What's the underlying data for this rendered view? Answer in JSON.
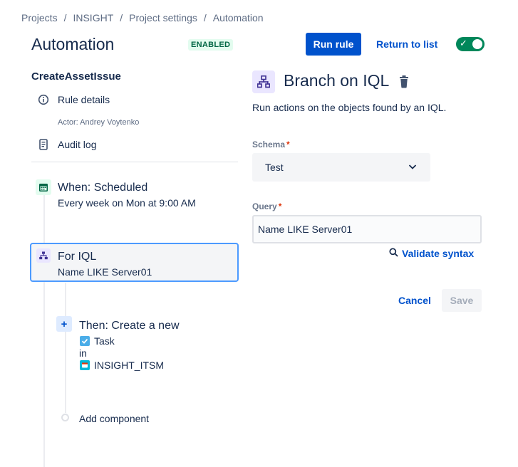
{
  "breadcrumb": {
    "items": [
      "Projects",
      "INSIGHT",
      "Project settings",
      "Automation"
    ],
    "separator": "/"
  },
  "header": {
    "title": "Automation",
    "status": "ENABLED",
    "run_rule_label": "Run rule",
    "return_label": "Return to list",
    "enabled": true
  },
  "sidebar": {
    "rule_name": "CreateAssetIssue",
    "rule_details_label": "Rule details",
    "actor": "Actor: Andrey Voytenko",
    "audit_log_label": "Audit log"
  },
  "flow": {
    "trigger": {
      "title": "When: Scheduled",
      "subtitle": "Every week on Mon at 9:00 AM"
    },
    "branch": {
      "title": "For IQL",
      "subtitle": "Name LIKE Server01"
    },
    "action": {
      "title": "Then: Create a new",
      "issue_type": "Task",
      "in_label": "in",
      "project": "INSIGHT_ITSM"
    },
    "add_component_label": "Add component"
  },
  "panel": {
    "title": "Branch on IQL",
    "description": "Run actions on the objects found by an IQL.",
    "schema_label": "Schema",
    "schema_value": "Test",
    "query_label": "Query",
    "query_value": "Name LIKE Server01",
    "validate_label": "Validate syntax",
    "cancel_label": "Cancel",
    "save_label": "Save",
    "required_mark": "*"
  },
  "colors": {
    "primary": "#0052CC",
    "success": "#00875A",
    "selected_border": "#4C9AFF",
    "branch_bg": "#EAE6FF"
  }
}
